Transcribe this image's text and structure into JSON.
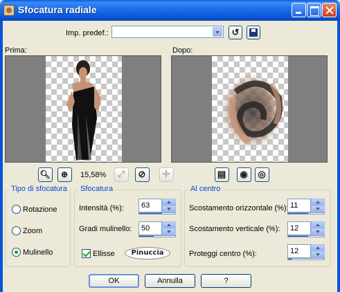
{
  "window": {
    "title": "Sfocatura radiale"
  },
  "preset": {
    "label": "Imp. predef.:",
    "value": ""
  },
  "panes": {
    "before_label": "Prima:",
    "after_label": "Dopo:"
  },
  "zoom": {
    "level": "15,58%"
  },
  "tipo": {
    "title": "Tipo di sfocatura",
    "options": [
      {
        "label": "Rotazione",
        "checked": false
      },
      {
        "label": "Zoom",
        "checked": false
      },
      {
        "label": "Mulinello",
        "checked": true
      }
    ]
  },
  "sfocatura": {
    "title": "Sfocatura",
    "intensita_label": "Intensità (%):",
    "intensita_value": "63",
    "gradi_label": "Gradi mulinello:",
    "gradi_value": "50",
    "ellisse_label": "Ellisse",
    "ellisse_checked": true,
    "watermark": "Pinuccia"
  },
  "centro": {
    "title": "Al centro",
    "orizz_label": "Scostamento orizzontale (%):",
    "orizz_value": "11",
    "vert_label": "Scostamento verticale (%):",
    "vert_value": "12",
    "proteggi_label": "Proteggi centro (%):",
    "proteggi_value": "12"
  },
  "buttons": {
    "ok": "OK",
    "cancel": "Annulla",
    "help": "?"
  },
  "colors": {
    "titlebar": "#0a55d6",
    "group_title": "#0046d5",
    "dialog_bg": "#ece9d8"
  }
}
